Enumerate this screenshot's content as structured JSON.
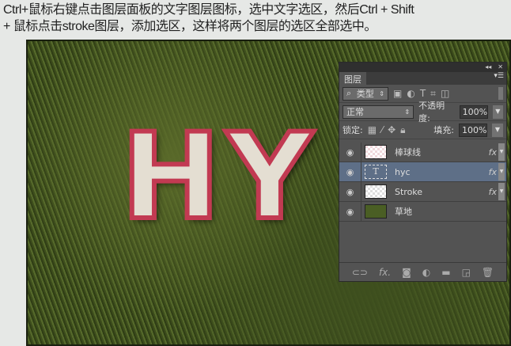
{
  "caption": {
    "line1": "Ctrl+鼠标右键点击图层面板的文字图层图标，选中文字选区，然后Ctrl + Shift",
    "line2": " + 鼠标点击stroke图层，添加选区，这样将两个图层的选区全部选中。"
  },
  "canvas": {
    "artwork_text": "HY"
  },
  "panel": {
    "tab": "图层",
    "filter": "类型",
    "blend_mode": "正常",
    "opacity_label": "不透明度:",
    "opacity": "100%",
    "lock_label": "锁定:",
    "fill_label": "填充:",
    "fill": "100%",
    "layers": [
      {
        "name": "棒球线",
        "fx": "fx"
      },
      {
        "name": "hyc",
        "fx": "fx",
        "thumb": "T"
      },
      {
        "name": "Stroke",
        "fx": "fx"
      },
      {
        "name": "草地"
      }
    ]
  }
}
